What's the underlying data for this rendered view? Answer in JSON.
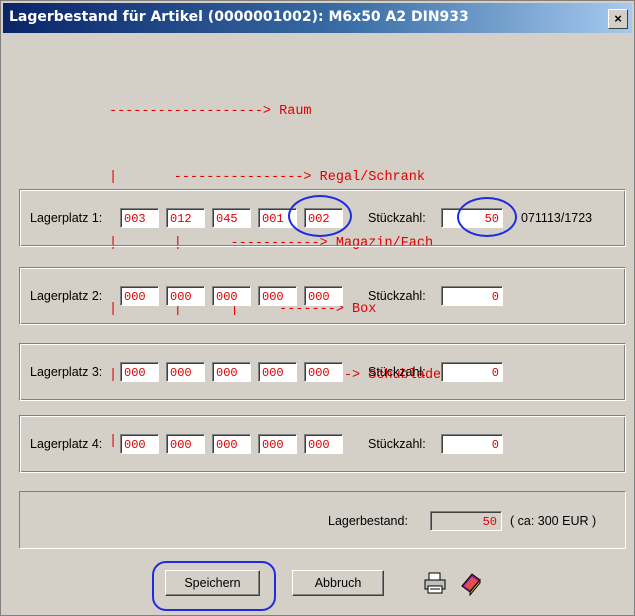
{
  "window": {
    "title": "Lagerbestand für Artikel (0000001002): M6x50 A2 DIN933",
    "close_label": "×"
  },
  "legend": {
    "lines": [
      "-------------------> Raum",
      "|       ----------------> Regal/Schrank",
      "|       |      -----------> Magazin/Fach",
      "|       |      |     -------> Box",
      "|       |      |     |     ---> Schublade",
      "|       |      |     |     |"
    ]
  },
  "lagerplaetze": [
    {
      "label": "Lagerplatz 1:",
      "segments": [
        "003",
        "012",
        "045",
        "001",
        "002"
      ],
      "stueckzahl_label": "Stückzahl:",
      "stueckzahl": "50",
      "extra": "071113/1723"
    },
    {
      "label": "Lagerplatz 2:",
      "segments": [
        "000",
        "000",
        "000",
        "000",
        "000"
      ],
      "stueckzahl_label": "Stückzahl:",
      "stueckzahl": "0",
      "extra": ""
    },
    {
      "label": "Lagerplatz 3:",
      "segments": [
        "000",
        "000",
        "000",
        "000",
        "000"
      ],
      "stueckzahl_label": "Stückzahl:",
      "stueckzahl": "0",
      "extra": ""
    },
    {
      "label": "Lagerplatz 4:",
      "segments": [
        "000",
        "000",
        "000",
        "000",
        "000"
      ],
      "stueckzahl_label": "Stückzahl:",
      "stueckzahl": "0",
      "extra": ""
    }
  ],
  "summary": {
    "label": "Lagerbestand:",
    "value": "50",
    "note": "( ca: 300 EUR )"
  },
  "buttons": {
    "save": "Speichern",
    "cancel": "Abbruch"
  },
  "icons": {
    "print": "printer-icon",
    "book": "book-icon"
  },
  "colors": {
    "title_start": "#0a246a",
    "field_text": "#e00000",
    "annotation": "#1e2ce0"
  }
}
